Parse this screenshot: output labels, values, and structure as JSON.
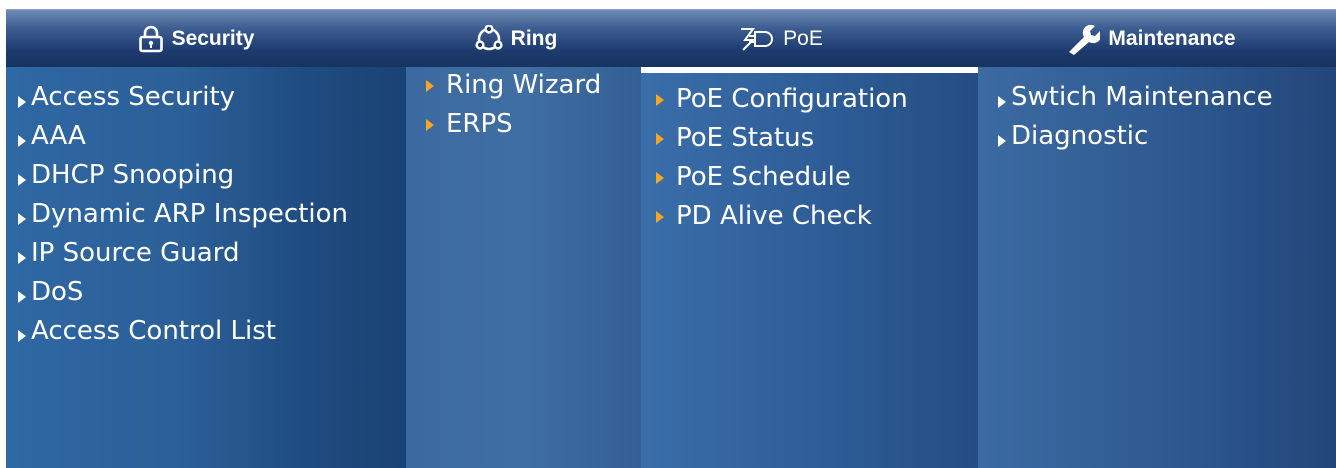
{
  "colors": {
    "header_top": "#6f8bb5",
    "header_bottom": "#17335f",
    "panel": "#2f5e98",
    "text": "#ffffff",
    "orange_arrow": "#f5a623"
  },
  "header": {
    "security": {
      "label": "Security",
      "icon": "lock-icon"
    },
    "ring": {
      "label": "Ring",
      "icon": "ring-icon"
    },
    "poe": {
      "label": "PoE",
      "icon": "poe-icon"
    },
    "maintenance": {
      "label": "Maintenance",
      "icon": "wrench-icon"
    }
  },
  "security": {
    "items": [
      "Access Security",
      "AAA",
      "DHCP Snooping",
      "Dynamic ARP Inspection",
      "IP Source Guard",
      "DoS",
      "Access Control List"
    ]
  },
  "ring": {
    "items": [
      "Ring Wizard",
      "ERPS"
    ]
  },
  "poe": {
    "items": [
      "PoE Configuration",
      "PoE Status",
      "PoE Schedule",
      "PD Alive Check"
    ]
  },
  "maintenance": {
    "items": [
      "Swtich Maintenance",
      "Diagnostic"
    ]
  }
}
